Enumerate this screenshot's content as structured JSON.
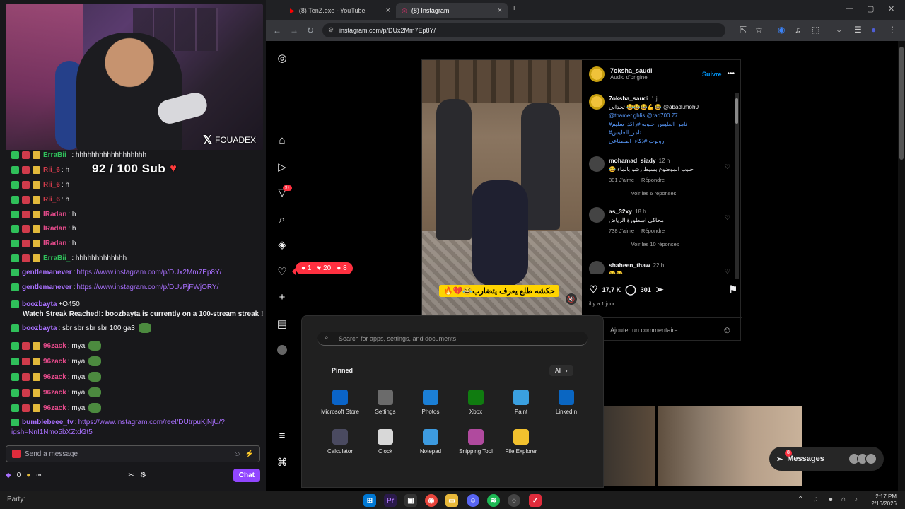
{
  "stream": {
    "webcam_handle": "FOUADEX",
    "sub_goal": "92 / 100 Sub",
    "messages": [
      {
        "user": "ErraBii_",
        "text": ": hhhhhhhhhhhhhhhhhh",
        "color": "#2fbf5a",
        "type": "text"
      },
      {
        "user": "Rii_6",
        "text": ": h",
        "color": "#d03b4b",
        "type": "text"
      },
      {
        "user": "Rii_6",
        "text": ": h",
        "color": "#d03b4b",
        "type": "text"
      },
      {
        "user": "Rii_6",
        "text": ": h",
        "color": "#d03b4b",
        "type": "text"
      },
      {
        "user": "lRadan",
        "text": ": h",
        "color": "#e34a8a",
        "type": "text"
      },
      {
        "user": "lRadan",
        "text": ": h",
        "color": "#e34a8a",
        "type": "text"
      },
      {
        "user": "lRadan",
        "text": ": h",
        "color": "#e34a8a",
        "type": "text"
      },
      {
        "user": "ErraBii_",
        "text": ": hhhhhhhhhhhhh",
        "color": "#2fbf5a",
        "type": "text"
      },
      {
        "user": "gentlemanever",
        "text": ": ",
        "link": "https://www.instagram.com/p/DUx2Mm7Ep8Y/",
        "color": "#a970ff",
        "type": "link"
      },
      {
        "user": "gentlemanever",
        "text": ": ",
        "link": "https://www.instagram.com/p/DUvPjFWjORY/",
        "color": "#a970ff",
        "type": "link"
      },
      {
        "user": "boozbayta",
        "text": " +O450",
        "color": "#a970ff",
        "type": "text"
      },
      {
        "user": "",
        "text": "Watch Streak Reached!: boozbayta is currently on a 100-stream streak !",
        "color": "#ffffff",
        "type": "notice"
      },
      {
        "user": "boozbayta",
        "text": ": sbr sbr sbr sbr 100 ga3",
        "color": "#a970ff",
        "type": "text"
      },
      {
        "user": "96zack",
        "text": ": mya",
        "color": "#e34a8a",
        "type": "text"
      },
      {
        "user": "96zack",
        "text": ": mya",
        "color": "#e34a8a",
        "type": "text"
      },
      {
        "user": "96zack",
        "text": ": mya",
        "color": "#e34a8a",
        "type": "text"
      },
      {
        "user": "96zack",
        "text": ": mya",
        "color": "#e34a8a",
        "type": "text"
      },
      {
        "user": "96zack",
        "text": ": mya",
        "color": "#e34a8a",
        "type": "text"
      },
      {
        "user": "bumblebeee_tv",
        "text": ": ",
        "link": "https://www.instagram.com/reel/DUtrpuKjNjU/?",
        "color": "#a970ff",
        "type": "link"
      },
      {
        "user": "",
        "text": "igsh=NnI1Nmo5bXZtdGt5",
        "color": "#a970ff",
        "type": "linkcont"
      }
    ],
    "input_placeholder": "Send a message",
    "points": "0",
    "chat_button": "Chat",
    "infinity": "∞"
  },
  "browser": {
    "tabs": [
      {
        "title": "(8) TenZ.exe - YouTube",
        "icon": "youtube-icon",
        "color": "#ff0000"
      },
      {
        "title": "(8) Instagram",
        "icon": "instagram-icon",
        "color": "#e1306c"
      }
    ],
    "url": "instagram.com/p/DUx2Mm7Ep8Y/"
  },
  "instagram": {
    "notif_badge": "9+",
    "notif_bubble": {
      "comments": "1",
      "likes": "20",
      "follows": "8"
    },
    "post": {
      "author": "7oksha_saudi",
      "audio": "Audio d'origine",
      "follow": "Suivre",
      "caption_user": "7oksha_saudi",
      "caption_time": "1 j",
      "caption_line1": "تحداني 😂😂😂💪😂 @abadi.moh0",
      "caption_line2": "@thamer.ghlis @rad700.77",
      "caption_line3": "#تامر_الغليس_حبوبه #راكد_سليم",
      "caption_line4": "#تامر_الغليس",
      "caption_line5": "روبوت #ذكاء_اصطناعي",
      "video_caption": "حكشه طلع يعرف يتضارب😂💔🔥",
      "likes": "17,7 K",
      "comments_count": "301",
      "time": "il y a 1 jour",
      "add_comment": "Ajouter un commentaire...",
      "comments": [
        {
          "user": "mohamad_siady",
          "time": "12 h",
          "text": "😂 حبيب الموضوع بسيط رشو بالماء",
          "likes": "301 J'aime",
          "reply": "Répondre",
          "replies": "Voir les 6 réponses"
        },
        {
          "user": "as_32xy",
          "time": "18 h",
          "text": "محاكي اسطورة الرياض",
          "likes": "738 J'aime",
          "reply": "Répondre",
          "replies": "Voir les 10 réponses"
        },
        {
          "user": "shaheen_thaw",
          "time": "22 h",
          "text": "😂😂",
          "likes": "",
          "reply": "",
          "replies": ""
        }
      ]
    },
    "messages_label": "Messages",
    "messages_badge": "8"
  },
  "start_menu": {
    "search_placeholder": "Search for apps, settings, and documents",
    "pinned": "Pinned",
    "all": "All",
    "apps": [
      {
        "name": "Microsoft Store",
        "color": "#0a64c8"
      },
      {
        "name": "Settings",
        "color": "#6b6b6b"
      },
      {
        "name": "Photos",
        "color": "#1b7fd6"
      },
      {
        "name": "Xbox",
        "color": "#107c10"
      },
      {
        "name": "Paint",
        "color": "#3aa0e0"
      },
      {
        "name": "LinkedIn",
        "color": "#0a66c2"
      },
      {
        "name": "Calculator",
        "color": "#4a4a60"
      },
      {
        "name": "Clock",
        "color": "#d8d8d8"
      },
      {
        "name": "Notepad",
        "color": "#3d9be0"
      },
      {
        "name": "Snipping Tool",
        "color": "#b04a9e"
      },
      {
        "name": "File Explorer",
        "color": "#f2c12e"
      }
    ]
  },
  "taskbar": {
    "party": "Party:",
    "time": "2:17 PM",
    "date": "2/16/2026"
  }
}
